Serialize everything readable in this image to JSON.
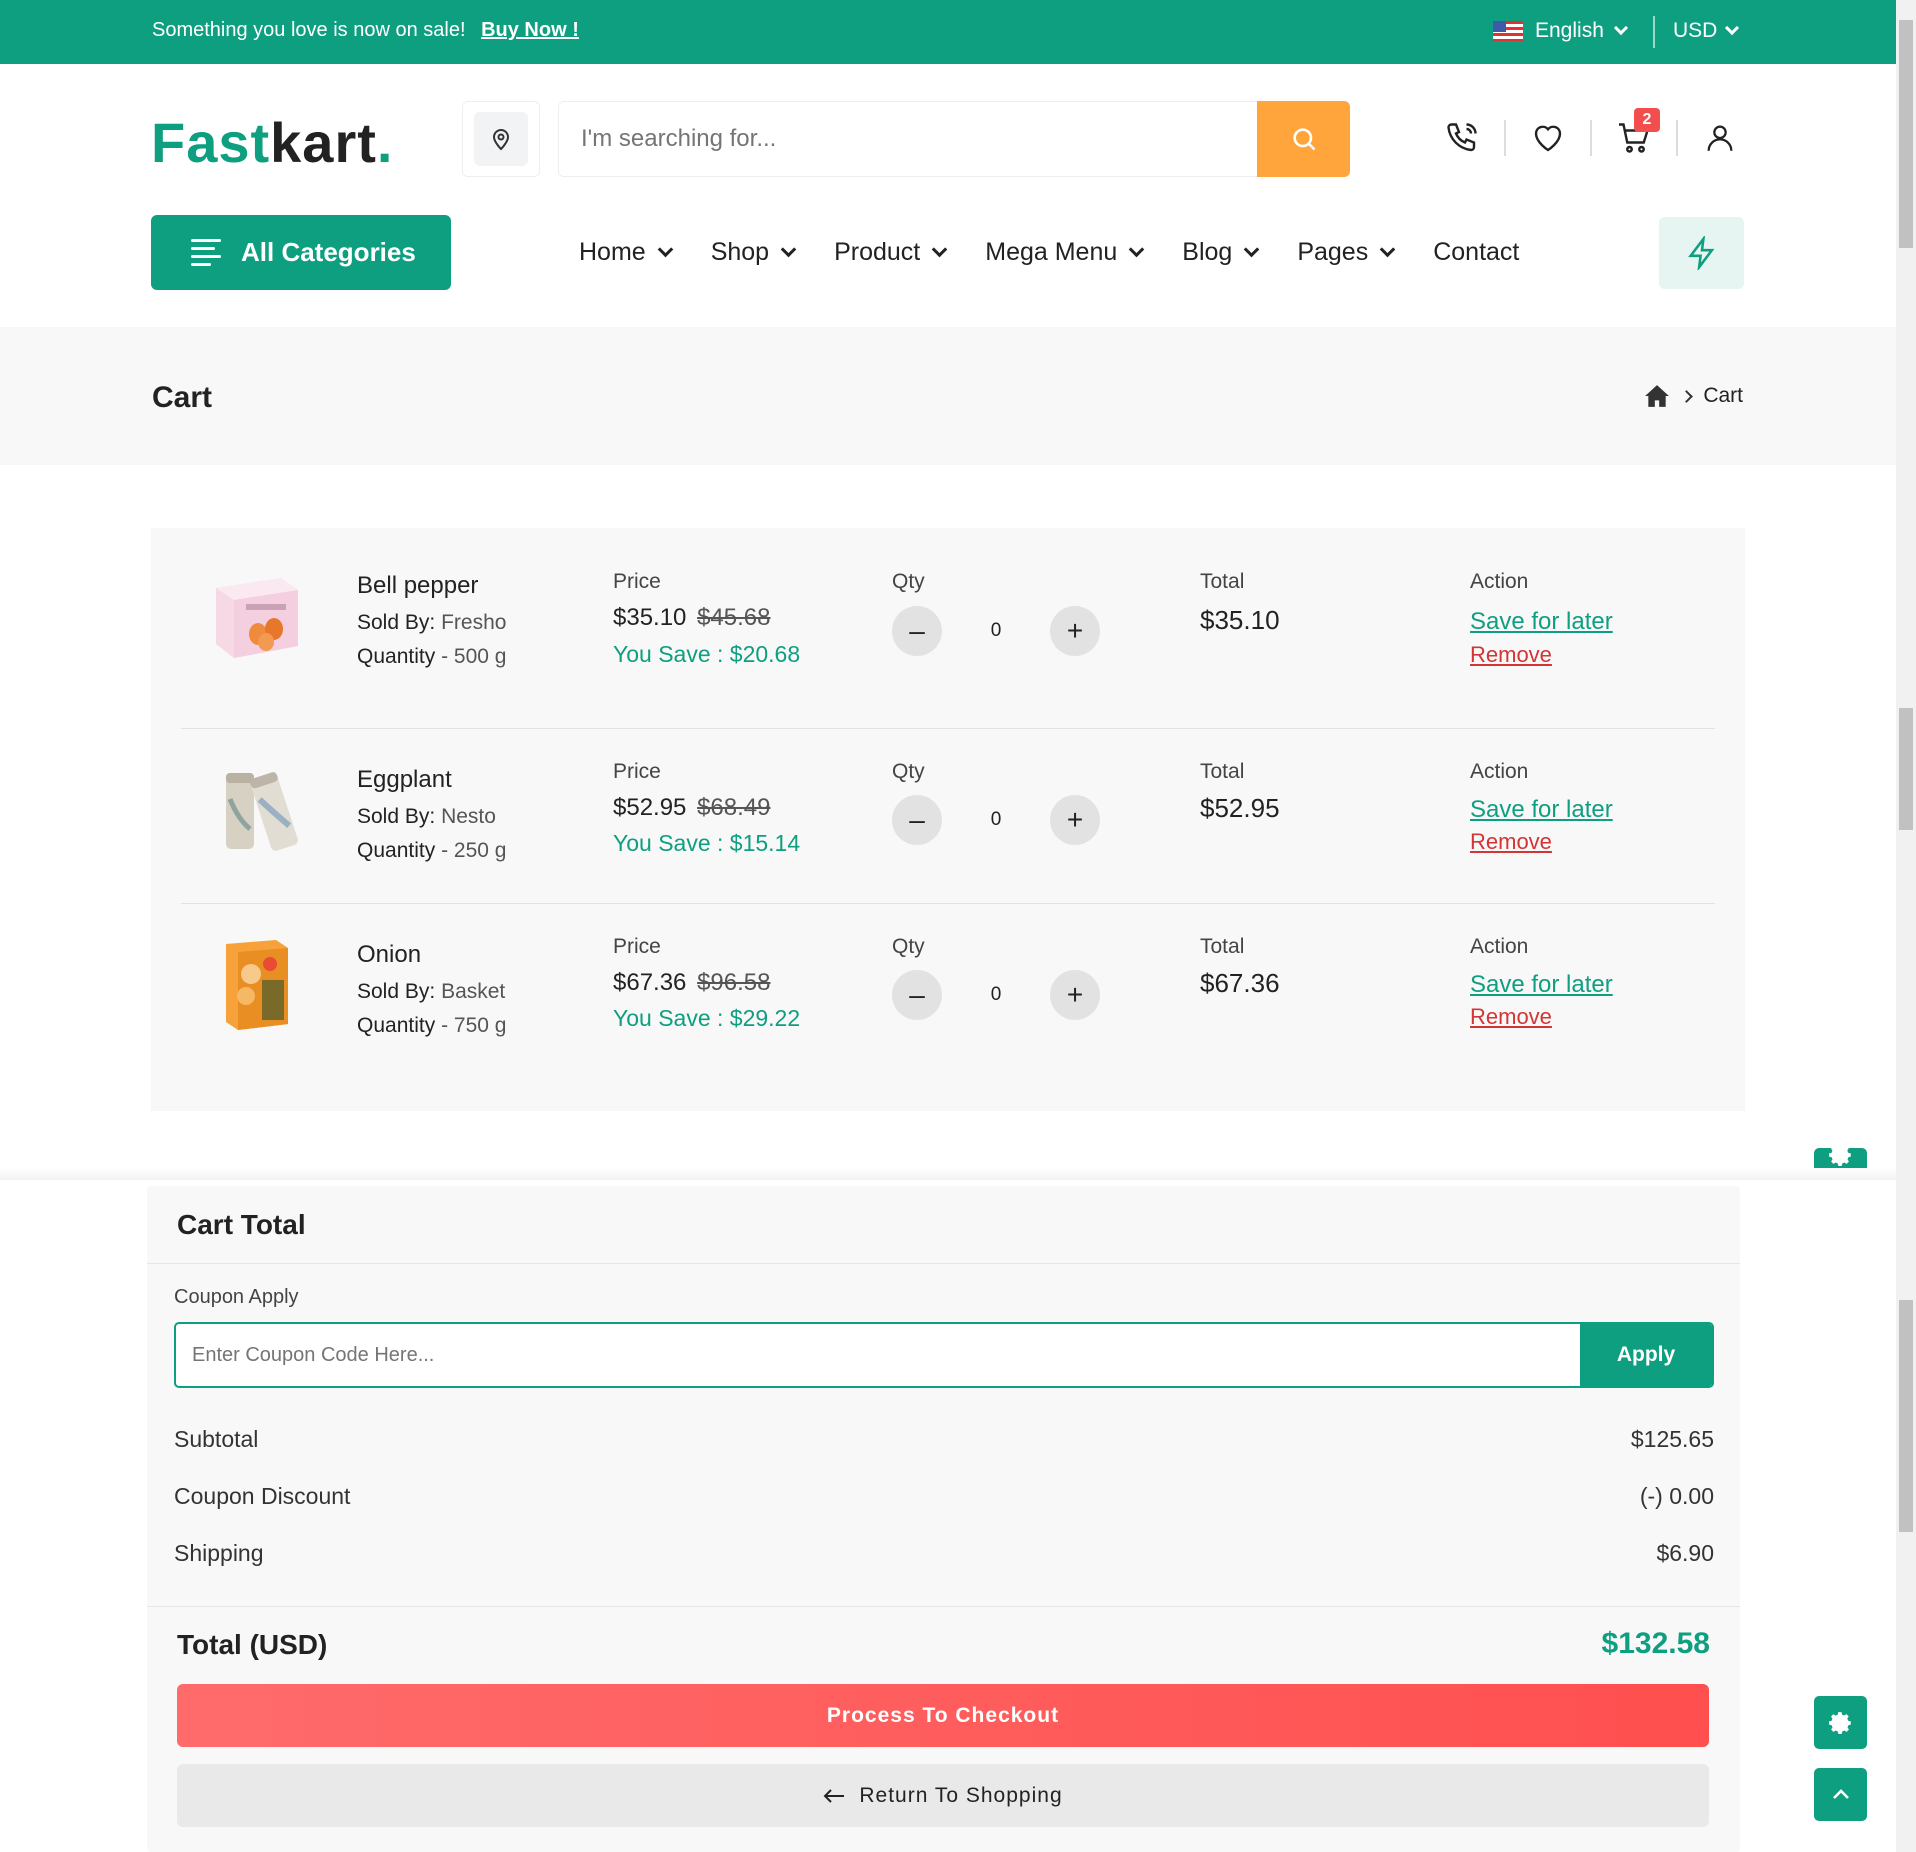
{
  "topbar": {
    "promo_text": "Something you love is now on sale!",
    "promo_link": "Buy Now !",
    "language": "English",
    "currency": "USD",
    "bg_color": "#0e9f80"
  },
  "header": {
    "logo_part1": "Fast",
    "logo_part2": "kart",
    "logo_dot": ".",
    "search_placeholder": "I'm searching for...",
    "cart_count": "2",
    "icons": [
      "location-icon",
      "search-icon",
      "phone-icon",
      "heart-icon",
      "cart-icon",
      "user-icon"
    ]
  },
  "nav": {
    "all_categories": "All Categories",
    "items": [
      {
        "label": "Home"
      },
      {
        "label": "Shop"
      },
      {
        "label": "Product"
      },
      {
        "label": "Mega Menu"
      },
      {
        "label": "Blog"
      },
      {
        "label": "Pages"
      },
      {
        "label": "Contact"
      }
    ]
  },
  "breadcrumb": {
    "title": "Cart",
    "current": "Cart"
  },
  "cart": {
    "col_price": "Price",
    "col_qty": "Qty",
    "col_total": "Total",
    "col_action": "Action",
    "sold_by_label": "Sold By:",
    "quantity_label": "Quantity",
    "save_for_later": "Save for later",
    "remove": "Remove",
    "items": [
      {
        "name": "Bell pepper",
        "seller": "Fresho",
        "quantity": "- 500 g",
        "price": "$35.10",
        "old_price": "$45.68",
        "you_save": "You Save : $20.68",
        "qty": "0",
        "total": "$35.10"
      },
      {
        "name": "Eggplant",
        "seller": "Nesto",
        "quantity": "- 250 g",
        "price": "$52.95",
        "old_price": "$68.49",
        "you_save": "You Save : $15.14",
        "qty": "0",
        "total": "$52.95"
      },
      {
        "name": "Onion",
        "seller": "Basket",
        "quantity": "- 750 g",
        "price": "$67.36",
        "old_price": "$96.58",
        "you_save": "You Save : $29.22",
        "qty": "0",
        "total": "$67.36"
      }
    ]
  },
  "cart_total": {
    "title": "Cart Total",
    "coupon_label": "Coupon Apply",
    "coupon_placeholder": "Enter Coupon Code Here...",
    "apply_label": "Apply",
    "subtotal_label": "Subtotal",
    "subtotal_value": "$125.65",
    "discount_label": "Coupon Discount",
    "discount_value": "(-) 0.00",
    "shipping_label": "Shipping",
    "shipping_value": "$6.90",
    "total_label": "Total (USD)",
    "total_value": "$132.58",
    "checkout_label": "Process To Checkout",
    "return_label": "Return To Shopping"
  }
}
